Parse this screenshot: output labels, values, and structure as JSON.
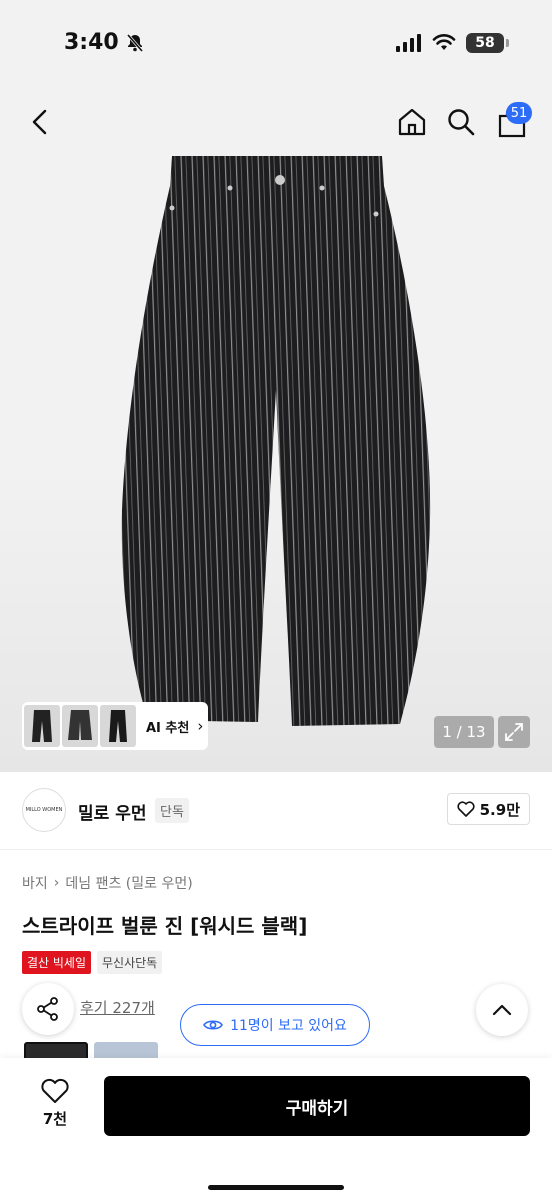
{
  "status_bar": {
    "time": "3:40",
    "battery": "58"
  },
  "header": {
    "cart_count": "51"
  },
  "gallery": {
    "ai_label": "AI 추천",
    "counter": "1 / 13",
    "pattern_colors": {
      "pants": "#1d1d1f",
      "stripe": "#9a9a9a"
    }
  },
  "brand": {
    "logo_text": "MILLO WOMEN",
    "name": "밀로 우먼",
    "tag": "단독",
    "likes": "5.9만"
  },
  "product": {
    "breadcrumb": [
      "바지",
      "데님 팬츠 (밀로 우먼)"
    ],
    "title": "스트라이프 벌룬 진 [워시드 블랙]",
    "badges": {
      "sale": "결산 빅세일",
      "exclusive": "무신사단독"
    },
    "reviews": "후기 227개",
    "watching": "11명이 보고 있어요"
  },
  "bottom": {
    "wish_count": "7천",
    "buy_label": "구매하기"
  },
  "colors": {
    "accent_blue": "#2d6cf6",
    "sale_red": "#e0141e",
    "buy_button": "#000000"
  }
}
